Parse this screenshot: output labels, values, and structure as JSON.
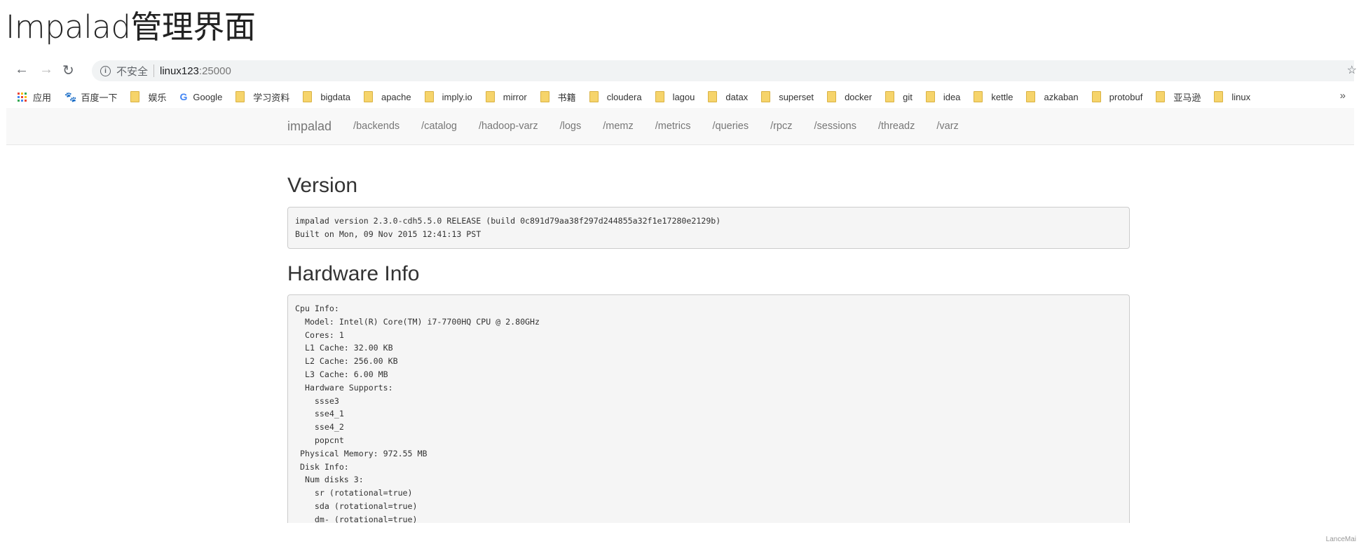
{
  "title": "Impalad管理界面",
  "browser": {
    "back_icon": "arrow-left-icon",
    "forward_icon": "arrow-right-icon",
    "reload_icon": "reload-icon",
    "security_label": "不安全",
    "url_host": "linux123",
    "url_port": ":25000",
    "bookmarks": [
      "应用",
      "百度一下",
      "娱乐",
      "Google",
      "学习资料",
      "bigdata",
      "apache",
      "imply.io",
      "mirror",
      "书籍",
      "cloudera",
      "lagou",
      "datax",
      "superset",
      "docker",
      "git",
      "idea",
      "kettle",
      "azkaban",
      "protobuf",
      "亚马逊",
      "linux"
    ],
    "more_label": "»"
  },
  "nav": {
    "brand": "impalad",
    "items": [
      "/backends",
      "/catalog",
      "/hadoop-varz",
      "/logs",
      "/memz",
      "/metrics",
      "/queries",
      "/rpcz",
      "/sessions",
      "/threadz",
      "/varz"
    ]
  },
  "version": {
    "heading": "Version",
    "text": "impalad version 2.3.0-cdh5.5.0 RELEASE (build 0c891d79aa38f297d244855a32f1e17280e2129b)\nBuilt on Mon, 09 Nov 2015 12:41:13 PST"
  },
  "hardware": {
    "heading": "Hardware Info",
    "text": "Cpu Info:\n  Model: Intel(R) Core(TM) i7-7700HQ CPU @ 2.80GHz\n  Cores: 1\n  L1 Cache: 32.00 KB\n  L2 Cache: 256.00 KB\n  L3 Cache: 6.00 MB\n  Hardware Supports:\n    ssse3\n    sse4_1\n    sse4_2\n    popcnt\n Physical Memory: 972.55 MB\n Disk Info:\n  Num disks 3:\n    sr (rotational=true)\n    sda (rotational=true)\n    dm- (rotational=true)"
  },
  "watermark": "LanceMai"
}
